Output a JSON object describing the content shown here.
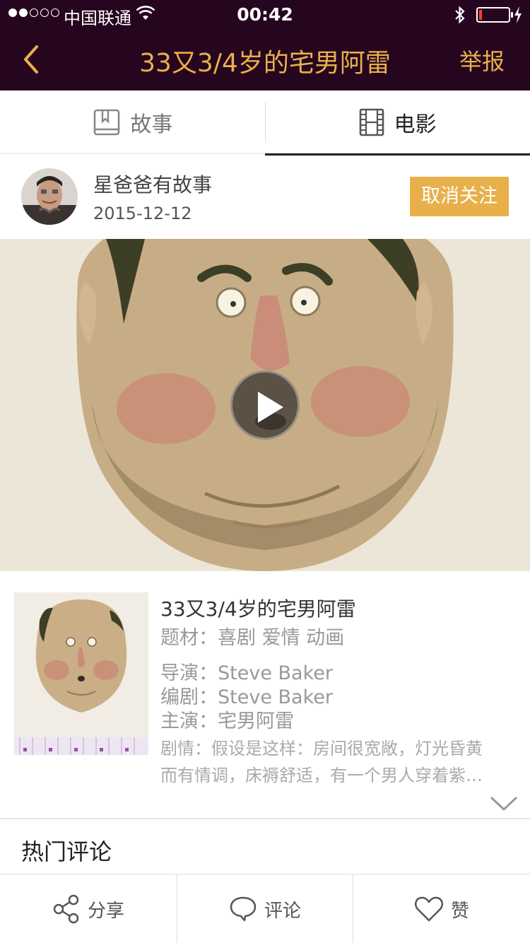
{
  "status_bar": {
    "carrier": "中国联通",
    "time": "00:42",
    "signal_level": 2,
    "battery_level": 0.1
  },
  "nav": {
    "title": "33又3/4岁的宅男阿雷",
    "report_label": "举报"
  },
  "tabs": [
    {
      "label": "故事",
      "icon": "book-icon",
      "selected": false
    },
    {
      "label": "电影",
      "icon": "film-icon",
      "selected": true
    }
  ],
  "author": {
    "name": "星爸爸有故事",
    "date": "2015-12-12",
    "unfollow_label": "取消关注"
  },
  "movie": {
    "title": "33又3/4岁的宅男阿雷",
    "genre": "题材：喜剧 爱情 动画",
    "director": "导演：Steve Baker",
    "writer": "编剧：Steve Baker",
    "cast": "主演：宅男阿雷",
    "plot_line1": "剧情：假设是这样：房间很宽敞，灯光昏黄",
    "plot_line2": "而有情调，床褥舒适，有一个男人穿着紫…"
  },
  "comments": {
    "heading": "热门评论"
  },
  "toolbar": {
    "share_label": "分享",
    "comment_label": "评论",
    "like_label": "赞"
  },
  "colors": {
    "nav_background": "#26061f",
    "accent": "#e8b04a"
  }
}
